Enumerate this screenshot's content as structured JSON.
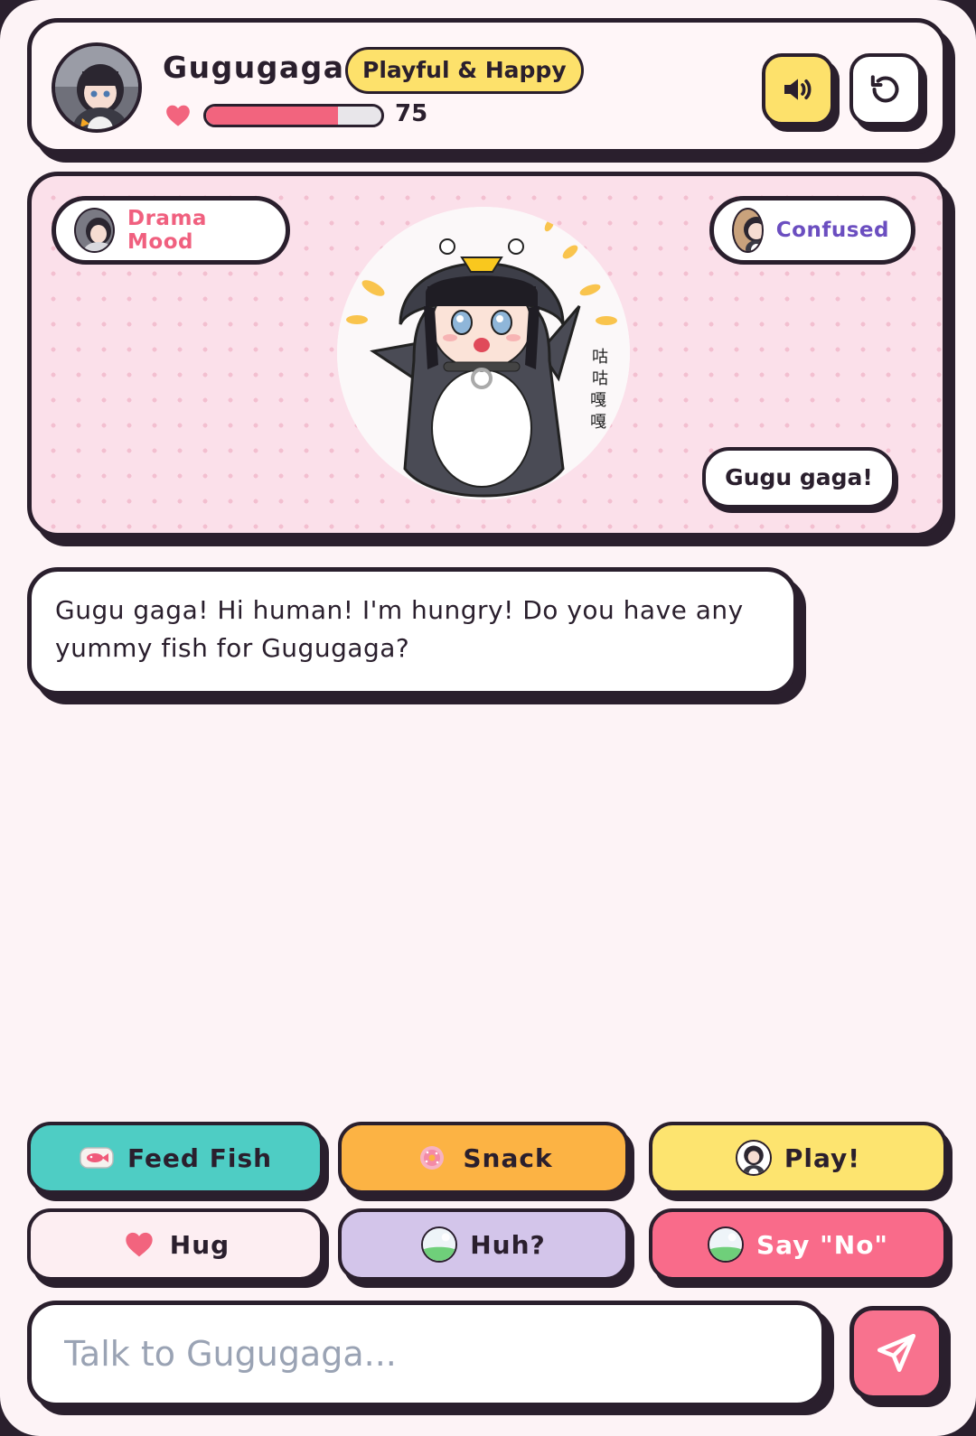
{
  "pet": {
    "name": "Gugugaga",
    "mood": "Playful & Happy",
    "affection": 75,
    "affection_max": 100
  },
  "header": {
    "sound_icon": "speaker-icon",
    "reset_icon": "rotate-ccw-icon"
  },
  "stage": {
    "mood_left": "Drama Mood",
    "mood_right": "Confused",
    "speech": "Gugu gaga!"
  },
  "message": {
    "text": "Gugu gaga! Hi human! I'm hungry! Do you have any yummy fish for Gugugaga?"
  },
  "actions": [
    {
      "label": "Feed Fish",
      "icon": "fish-icon"
    },
    {
      "label": "Snack",
      "icon": "donut-icon"
    },
    {
      "label": "Play!",
      "icon": "penguin-avatar-icon"
    },
    {
      "label": "Hug",
      "icon": "heart-icon"
    },
    {
      "label": "Huh?",
      "icon": "globe-icon"
    },
    {
      "label": "Say \"No\"",
      "icon": "globe-icon"
    }
  ],
  "input": {
    "placeholder": "Talk to Gugugaga...",
    "value": ""
  },
  "colors": {
    "pink": "#f2647e",
    "yellow": "#fde16b",
    "teal": "#4ecdc4",
    "orange": "#fcb344",
    "lavender": "#d3c5ea",
    "outline": "#2a1f2d"
  }
}
